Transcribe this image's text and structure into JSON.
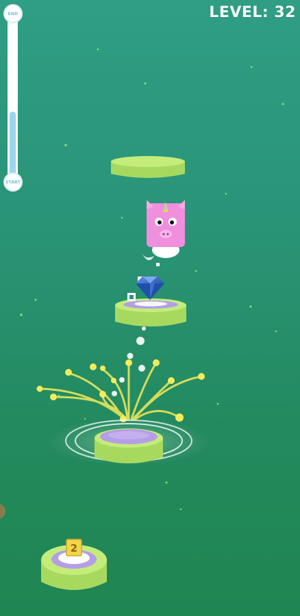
{
  "hud": {
    "level_label": "LEVEL: 32",
    "progress_end_label": "END",
    "progress_start_label": "START",
    "progress_fraction": 0.42
  },
  "sign": {
    "symbol": "2"
  },
  "colors": {
    "platform_top": "#c4ec7a",
    "platform_side": "#a8d95f",
    "platform_center": "#b59ee6",
    "character": "#f08fdd",
    "gem": "#1f4fa8",
    "sparks": "#f3ec5a",
    "progress_fill": "#9fd3ee"
  },
  "icons": {
    "character": "unicorn-cube-icon",
    "gem": "diamond-gem-icon",
    "sign": "number-sign-icon"
  }
}
